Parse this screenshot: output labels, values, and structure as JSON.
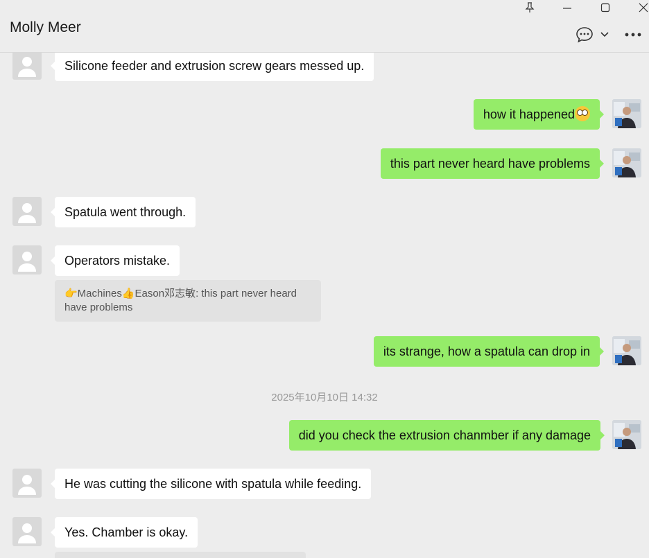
{
  "header": {
    "title": "Molly Meer",
    "icons": [
      "pin-icon",
      "minimize-icon",
      "maximize-icon",
      "close-icon",
      "chat-bubble-icon",
      "chevron-down-icon",
      "more-icon"
    ]
  },
  "messages": [
    {
      "side": "in",
      "text": "Silicone feeder and extrusion screw gears messed up."
    },
    {
      "side": "out",
      "text": "how it happened",
      "emoji": "😳"
    },
    {
      "side": "out",
      "text": "this part never heard have problems"
    },
    {
      "side": "in",
      "text": "Spatula went through."
    },
    {
      "side": "in",
      "text": "Operators mistake."
    },
    {
      "quote": "👉Machines👍Eason邓志敏: this part never heard have problems"
    },
    {
      "side": "out",
      "text": "its strange, how a spatula can drop in"
    },
    {
      "timestamp": "2025年10月10日 14:32"
    },
    {
      "side": "out",
      "text": "did you check the extrusion chanmber if any damage"
    },
    {
      "side": "in",
      "text": "He was cutting the silicone with spatula while feeding."
    },
    {
      "side": "in",
      "text": "Yes. Chamber is okay."
    }
  ],
  "colors": {
    "background": "#ededed",
    "incoming": "#ffffff",
    "outgoing": "#95ec69",
    "quote": "#e2e2e2"
  }
}
